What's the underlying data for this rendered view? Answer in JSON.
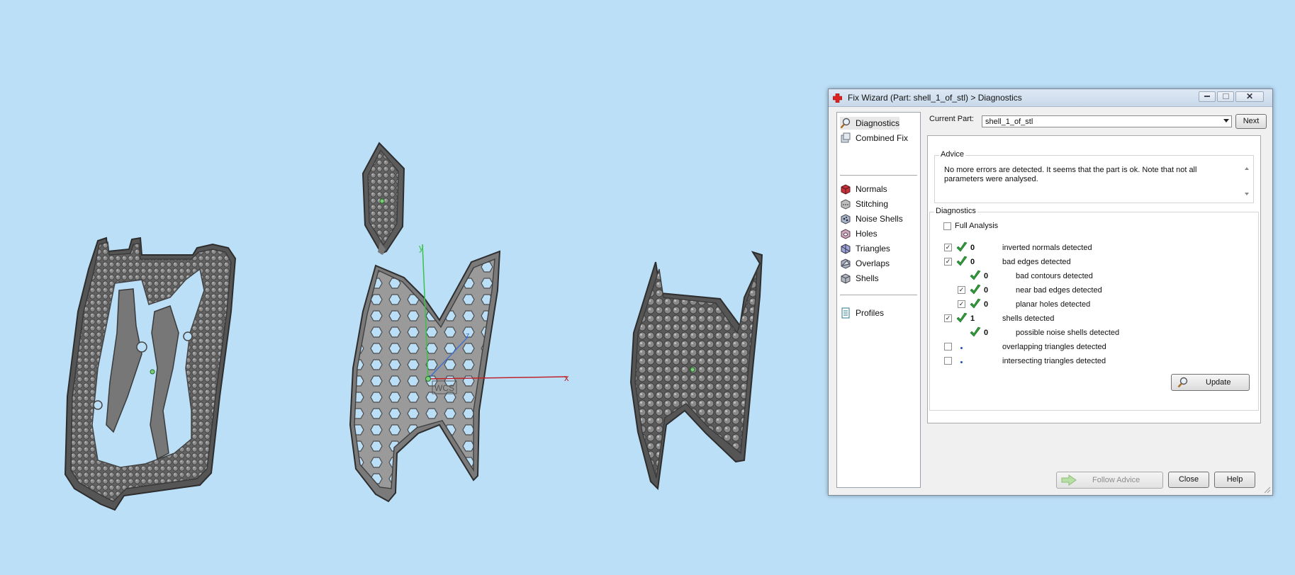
{
  "viewport": {
    "axis_y_label": "y",
    "axis_x_label": "x",
    "axis_z_label": "z",
    "wcs_label": "WCS"
  },
  "dialog": {
    "title": "Fix Wizard (Part: shell_1_of_stl) > Diagnostics",
    "nav": {
      "top_items": [
        {
          "label": "Diagnostics",
          "icon": "magnifier-icon"
        },
        {
          "label": "Combined Fix",
          "icon": "combined-fix-icon"
        }
      ],
      "fix_items": [
        {
          "label": "Normals",
          "icon": "normals-icon"
        },
        {
          "label": "Stitching",
          "icon": "stitching-icon"
        },
        {
          "label": "Noise Shells",
          "icon": "noise-shells-icon"
        },
        {
          "label": "Holes",
          "icon": "holes-icon"
        },
        {
          "label": "Triangles",
          "icon": "triangles-icon"
        },
        {
          "label": "Overlaps",
          "icon": "overlaps-icon"
        },
        {
          "label": "Shells",
          "icon": "shells-icon"
        }
      ],
      "profiles_label": "Profiles"
    },
    "current_part_label": "Current Part:",
    "current_part_value": "shell_1_of_stl",
    "next_label": "Next",
    "advice_title": "Advice",
    "advice_text": "No more errors are detected. It seems that the part is ok. Note that not all parameters were analysed.",
    "diagnostics_title": "Diagnostics",
    "full_analysis_label": "Full Analysis",
    "rows": [
      {
        "checked": true,
        "status": "ok",
        "count": "0",
        "label": "inverted normals detected",
        "indent": 0
      },
      {
        "checked": true,
        "status": "ok",
        "count": "0",
        "label": "bad edges detected",
        "indent": 0
      },
      {
        "checked": null,
        "status": "ok",
        "count": "0",
        "label": "bad contours detected",
        "indent": 1
      },
      {
        "checked": true,
        "status": "ok",
        "count": "0",
        "label": "near bad edges detected",
        "indent": 1
      },
      {
        "checked": true,
        "status": "ok",
        "count": "0",
        "label": "planar holes detected",
        "indent": 1
      },
      {
        "checked": true,
        "status": "ok",
        "count": "1",
        "label": "shells detected",
        "indent": 0
      },
      {
        "checked": null,
        "status": "ok",
        "count": "0",
        "label": "possible noise shells detected",
        "indent": 1
      },
      {
        "checked": false,
        "status": "none",
        "count": "",
        "label": "overlapping triangles detected",
        "indent": 0
      },
      {
        "checked": false,
        "status": "none",
        "count": "",
        "label": "intersecting triangles detected",
        "indent": 0
      }
    ],
    "update_label": "Update",
    "follow_advice_label": "Follow Advice",
    "close_label": "Close",
    "help_label": "Help"
  }
}
